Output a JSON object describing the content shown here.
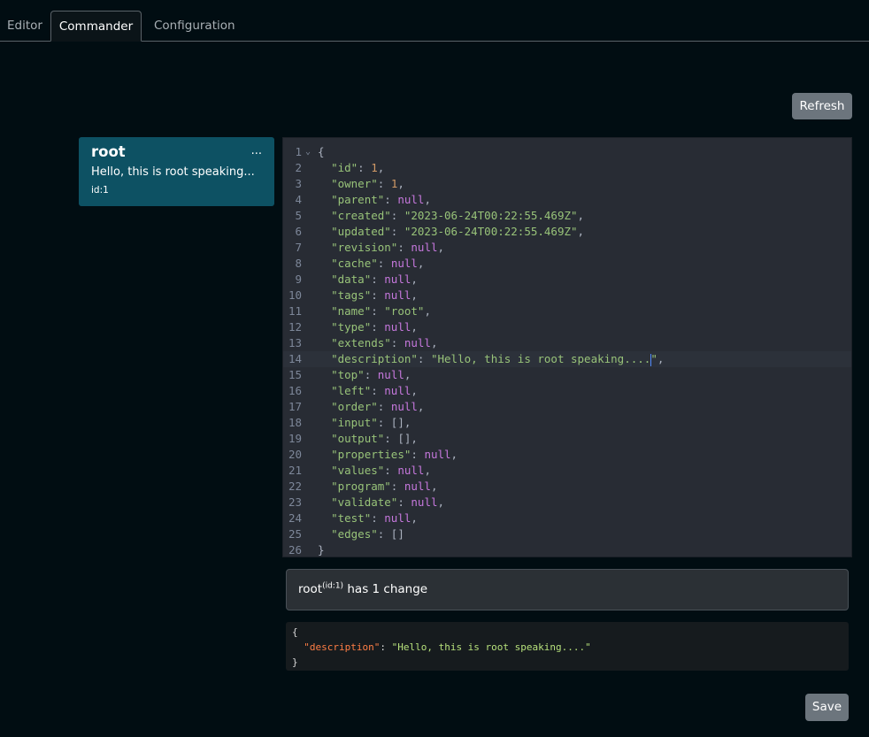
{
  "tabs": [
    {
      "label": "Editor",
      "active": false
    },
    {
      "label": "Commander",
      "active": true
    },
    {
      "label": "Configuration",
      "active": false
    }
  ],
  "toolbar": {
    "refresh_label": "Refresh",
    "save_label": "Save"
  },
  "node_card": {
    "name": "root",
    "menu_label": "...",
    "description": "Hello, this is root speaking...",
    "id_label": "id:1"
  },
  "editor": {
    "active_line": 14,
    "lines": [
      {
        "n": "1",
        "fold": true,
        "segs": [
          [
            "p",
            "{"
          ]
        ]
      },
      {
        "n": "2",
        "segs": [
          [
            "p",
            "  "
          ],
          [
            "k",
            "\"id\""
          ],
          [
            "p",
            ": "
          ],
          [
            "n",
            "1"
          ],
          [
            "p",
            ","
          ]
        ]
      },
      {
        "n": "3",
        "segs": [
          [
            "p",
            "  "
          ],
          [
            "k",
            "\"owner\""
          ],
          [
            "p",
            ": "
          ],
          [
            "n",
            "1"
          ],
          [
            "p",
            ","
          ]
        ]
      },
      {
        "n": "4",
        "segs": [
          [
            "p",
            "  "
          ],
          [
            "k",
            "\"parent\""
          ],
          [
            "p",
            ": "
          ],
          [
            "w",
            "null"
          ],
          [
            "p",
            ","
          ]
        ]
      },
      {
        "n": "5",
        "segs": [
          [
            "p",
            "  "
          ],
          [
            "k",
            "\"created\""
          ],
          [
            "p",
            ": "
          ],
          [
            "s",
            "\"2023-06-24T00:22:55.469Z\""
          ],
          [
            "p",
            ","
          ]
        ]
      },
      {
        "n": "6",
        "segs": [
          [
            "p",
            "  "
          ],
          [
            "k",
            "\"updated\""
          ],
          [
            "p",
            ": "
          ],
          [
            "s",
            "\"2023-06-24T00:22:55.469Z\""
          ],
          [
            "p",
            ","
          ]
        ]
      },
      {
        "n": "7",
        "segs": [
          [
            "p",
            "  "
          ],
          [
            "k",
            "\"revision\""
          ],
          [
            "p",
            ": "
          ],
          [
            "w",
            "null"
          ],
          [
            "p",
            ","
          ]
        ]
      },
      {
        "n": "8",
        "segs": [
          [
            "p",
            "  "
          ],
          [
            "k",
            "\"cache\""
          ],
          [
            "p",
            ": "
          ],
          [
            "w",
            "null"
          ],
          [
            "p",
            ","
          ]
        ]
      },
      {
        "n": "9",
        "segs": [
          [
            "p",
            "  "
          ],
          [
            "k",
            "\"data\""
          ],
          [
            "p",
            ": "
          ],
          [
            "w",
            "null"
          ],
          [
            "p",
            ","
          ]
        ]
      },
      {
        "n": "10",
        "segs": [
          [
            "p",
            "  "
          ],
          [
            "k",
            "\"tags\""
          ],
          [
            "p",
            ": "
          ],
          [
            "w",
            "null"
          ],
          [
            "p",
            ","
          ]
        ]
      },
      {
        "n": "11",
        "segs": [
          [
            "p",
            "  "
          ],
          [
            "k",
            "\"name\""
          ],
          [
            "p",
            ": "
          ],
          [
            "s",
            "\"root\""
          ],
          [
            "p",
            ","
          ]
        ]
      },
      {
        "n": "12",
        "segs": [
          [
            "p",
            "  "
          ],
          [
            "k",
            "\"type\""
          ],
          [
            "p",
            ": "
          ],
          [
            "w",
            "null"
          ],
          [
            "p",
            ","
          ]
        ]
      },
      {
        "n": "13",
        "segs": [
          [
            "p",
            "  "
          ],
          [
            "k",
            "\"extends\""
          ],
          [
            "p",
            ": "
          ],
          [
            "w",
            "null"
          ],
          [
            "p",
            ","
          ]
        ]
      },
      {
        "n": "14",
        "segs": [
          [
            "p",
            "  "
          ],
          [
            "k",
            "\"description\""
          ],
          [
            "p",
            ": "
          ],
          [
            "s",
            "\"Hello, this is root speaking...."
          ],
          [
            "c",
            ""
          ],
          [
            "s",
            "\""
          ],
          [
            "p",
            ","
          ]
        ]
      },
      {
        "n": "15",
        "segs": [
          [
            "p",
            "  "
          ],
          [
            "k",
            "\"top\""
          ],
          [
            "p",
            ": "
          ],
          [
            "w",
            "null"
          ],
          [
            "p",
            ","
          ]
        ]
      },
      {
        "n": "16",
        "segs": [
          [
            "p",
            "  "
          ],
          [
            "k",
            "\"left\""
          ],
          [
            "p",
            ": "
          ],
          [
            "w",
            "null"
          ],
          [
            "p",
            ","
          ]
        ]
      },
      {
        "n": "17",
        "segs": [
          [
            "p",
            "  "
          ],
          [
            "k",
            "\"order\""
          ],
          [
            "p",
            ": "
          ],
          [
            "w",
            "null"
          ],
          [
            "p",
            ","
          ]
        ]
      },
      {
        "n": "18",
        "segs": [
          [
            "p",
            "  "
          ],
          [
            "k",
            "\"input\""
          ],
          [
            "p",
            ": [],"
          ]
        ]
      },
      {
        "n": "19",
        "segs": [
          [
            "p",
            "  "
          ],
          [
            "k",
            "\"output\""
          ],
          [
            "p",
            ": [],"
          ]
        ]
      },
      {
        "n": "20",
        "segs": [
          [
            "p",
            "  "
          ],
          [
            "k",
            "\"properties\""
          ],
          [
            "p",
            ": "
          ],
          [
            "w",
            "null"
          ],
          [
            "p",
            ","
          ]
        ]
      },
      {
        "n": "21",
        "segs": [
          [
            "p",
            "  "
          ],
          [
            "k",
            "\"values\""
          ],
          [
            "p",
            ": "
          ],
          [
            "w",
            "null"
          ],
          [
            "p",
            ","
          ]
        ]
      },
      {
        "n": "22",
        "segs": [
          [
            "p",
            "  "
          ],
          [
            "k",
            "\"program\""
          ],
          [
            "p",
            ": "
          ],
          [
            "w",
            "null"
          ],
          [
            "p",
            ","
          ]
        ]
      },
      {
        "n": "23",
        "segs": [
          [
            "p",
            "  "
          ],
          [
            "k",
            "\"validate\""
          ],
          [
            "p",
            ": "
          ],
          [
            "w",
            "null"
          ],
          [
            "p",
            ","
          ]
        ]
      },
      {
        "n": "24",
        "segs": [
          [
            "p",
            "  "
          ],
          [
            "k",
            "\"test\""
          ],
          [
            "p",
            ": "
          ],
          [
            "w",
            "null"
          ],
          [
            "p",
            ","
          ]
        ]
      },
      {
        "n": "25",
        "segs": [
          [
            "p",
            "  "
          ],
          [
            "k",
            "\"edges\""
          ],
          [
            "p",
            ": []"
          ]
        ]
      },
      {
        "n": "26",
        "segs": [
          [
            "p",
            "}"
          ]
        ]
      }
    ]
  },
  "change": {
    "node_name": "root",
    "node_id_sup": "(id:1)",
    "text": " has 1 change"
  },
  "diff": {
    "open": "{",
    "key": "\"description\"",
    "sep": ": ",
    "value": "\"Hello, this is root speaking....\"",
    "close": "}"
  }
}
